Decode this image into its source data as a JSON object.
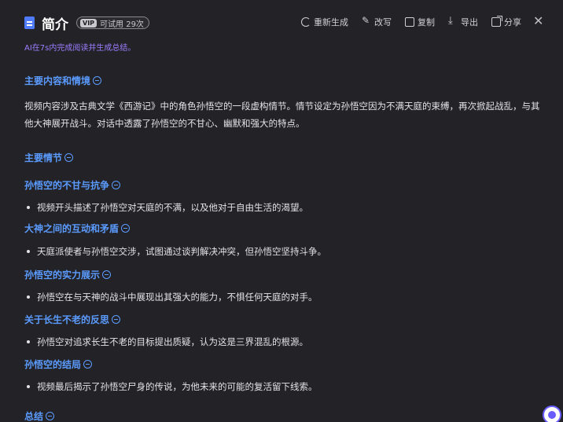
{
  "header": {
    "title": "简介",
    "vip_tag": "VIP",
    "trial_text": "可试用 29次",
    "actions": {
      "regenerate": "重新生成",
      "rewrite": "改写",
      "copy": "复制",
      "export": "导出",
      "share": "分享"
    },
    "close_label": "✕"
  },
  "ai_note": "AI在7s内完成阅读并生成总结。",
  "sections": {
    "main_content_title": "主要内容和情境",
    "main_content_text": "视频内容涉及古典文学《西游记》中的角色孙悟空的一段虚构情节。情节设定为孙悟空因为不满天庭的束缚，再次掀起战乱，与其他大神展开战斗。对话中透露了孙悟空的不甘心、幽默和强大的特点。",
    "main_plot_title": "主要情节",
    "plots": [
      {
        "title": "孙悟空的不甘与抗争",
        "bullet": "视频开头描述了孙悟空对天庭的不满，以及他对于自由生活的渴望。"
      },
      {
        "title": "大神之间的互动和矛盾",
        "bullet": "天庭派使者与孙悟空交涉，试图通过谈判解决冲突，但孙悟空坚持斗争。"
      },
      {
        "title": "孙悟空的实力展示",
        "bullet": "孙悟空在与天神的战斗中展现出其强大的能力，不惧任何天庭的对手。"
      },
      {
        "title": "关于长生不老的反思",
        "bullet": "孙悟空对追求长生不老的目标提出质疑，认为这是三界混乱的根源。"
      },
      {
        "title": "孙悟空的结局",
        "bullet": "视频最后揭示了孙悟空尸身的传说，为他未来的可能的复活留下线索。"
      }
    ],
    "summary_title": "总结"
  },
  "colors": {
    "background": "#232327",
    "heading": "#5b9bff",
    "ai_note": "#9b7dff",
    "text": "#e3e3e6"
  }
}
